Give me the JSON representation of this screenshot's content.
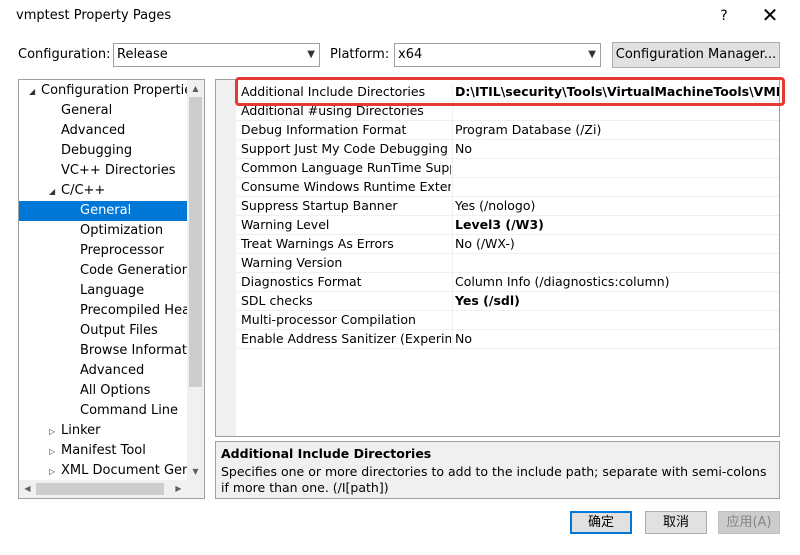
{
  "window": {
    "title": "vmptest Property Pages",
    "help_glyph": "?",
    "close_glyph": "✕"
  },
  "toolbar": {
    "configuration_label": "Configuration:",
    "configuration_value": "Release",
    "platform_label": "Platform:",
    "platform_value": "x64",
    "config_manager_label": "Configuration Manager..."
  },
  "tree": {
    "items": [
      {
        "label": "Configuration Properties",
        "level": 0,
        "expander": "◢"
      },
      {
        "label": "General",
        "level": 1,
        "expander": ""
      },
      {
        "label": "Advanced",
        "level": 1,
        "expander": ""
      },
      {
        "label": "Debugging",
        "level": 1,
        "expander": ""
      },
      {
        "label": "VC++ Directories",
        "level": 1,
        "expander": ""
      },
      {
        "label": "C/C++",
        "level": 1,
        "expander": "◢"
      },
      {
        "label": "General",
        "level": 2,
        "expander": ""
      },
      {
        "label": "Optimization",
        "level": 2,
        "expander": ""
      },
      {
        "label": "Preprocessor",
        "level": 2,
        "expander": ""
      },
      {
        "label": "Code Generation",
        "level": 2,
        "expander": ""
      },
      {
        "label": "Language",
        "level": 2,
        "expander": ""
      },
      {
        "label": "Precompiled Headers",
        "level": 2,
        "expander": ""
      },
      {
        "label": "Output Files",
        "level": 2,
        "expander": ""
      },
      {
        "label": "Browse Information",
        "level": 2,
        "expander": ""
      },
      {
        "label": "Advanced",
        "level": 2,
        "expander": ""
      },
      {
        "label": "All Options",
        "level": 2,
        "expander": ""
      },
      {
        "label": "Command Line",
        "level": 2,
        "expander": ""
      },
      {
        "label": "Linker",
        "level": 1,
        "expander": "▷"
      },
      {
        "label": "Manifest Tool",
        "level": 1,
        "expander": "▷"
      },
      {
        "label": "XML Document Generator",
        "level": 1,
        "expander": "▷"
      }
    ],
    "selected_index": 6
  },
  "properties": [
    {
      "name": "Additional Include Directories",
      "value": "D:\\ITIL\\security\\Tools\\VirtualMachineTools\\VMProtect",
      "bold": true
    },
    {
      "name": "Additional #using Directories",
      "value": "",
      "bold": false
    },
    {
      "name": "Debug Information Format",
      "value": "Program Database (/Zi)",
      "bold": false
    },
    {
      "name": "Support Just My Code Debugging",
      "value": "No",
      "bold": false
    },
    {
      "name": "Common Language RunTime Support",
      "value": "",
      "bold": false
    },
    {
      "name": "Consume Windows Runtime Extension",
      "value": "",
      "bold": false
    },
    {
      "name": "Suppress Startup Banner",
      "value": "Yes (/nologo)",
      "bold": false
    },
    {
      "name": "Warning Level",
      "value": "Level3 (/W3)",
      "bold": true
    },
    {
      "name": "Treat Warnings As Errors",
      "value": "No (/WX-)",
      "bold": false
    },
    {
      "name": "Warning Version",
      "value": "",
      "bold": false
    },
    {
      "name": "Diagnostics Format",
      "value": "Column Info (/diagnostics:column)",
      "bold": false
    },
    {
      "name": "SDL checks",
      "value": "Yes (/sdl)",
      "bold": true
    },
    {
      "name": "Multi-processor Compilation",
      "value": "",
      "bold": false
    },
    {
      "name": "Enable Address Sanitizer (Experimental)",
      "value": "No",
      "bold": false
    }
  ],
  "description": {
    "title": "Additional Include Directories",
    "text": "Specifies one or more directories to add to the include path; separate with semi-colons if more than one.     (/I[path])"
  },
  "buttons": {
    "ok": "确定",
    "cancel": "取消",
    "apply": "应用(A)"
  },
  "colors": {
    "selection": "#0078d7",
    "highlight_box": "#e53935"
  }
}
